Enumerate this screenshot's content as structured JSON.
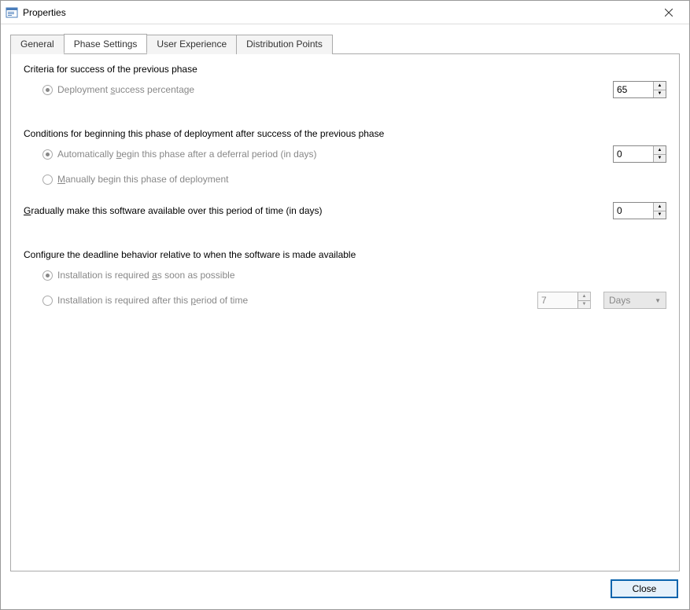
{
  "window": {
    "title": "Properties"
  },
  "tabs": {
    "general": "General",
    "phase_settings": "Phase Settings",
    "user_experience": "User Experience",
    "distribution_points": "Distribution Points",
    "active": "phase_settings"
  },
  "sections": {
    "criteria": {
      "label": "Criteria for success of the previous phase",
      "radio1_pre": "Deployment ",
      "radio1_u": "s",
      "radio1_post": "uccess percentage",
      "value": "65"
    },
    "conditions": {
      "label": "Conditions for beginning this phase of deployment after success of the previous phase",
      "radio1_pre": "Automatically ",
      "radio1_u": "b",
      "radio1_post": "egin this phase after a deferral period (in days)",
      "value": "0",
      "radio2_u": "M",
      "radio2_post": "anually begin this phase of deployment"
    },
    "gradual": {
      "label_u": "G",
      "label_post": "radually make this software available over this period of time (in days)",
      "value": "0"
    },
    "deadline": {
      "label": "Configure the deadline behavior relative to when the software is made available",
      "radio1_pre": "Installation is required ",
      "radio1_u": "a",
      "radio1_post": "s soon as possible",
      "radio2_pre": "Installation is required after this ",
      "radio2_u": "p",
      "radio2_post": "eriod of time",
      "period_value": "7",
      "unit": "Days"
    }
  },
  "footer": {
    "close": "Close"
  }
}
